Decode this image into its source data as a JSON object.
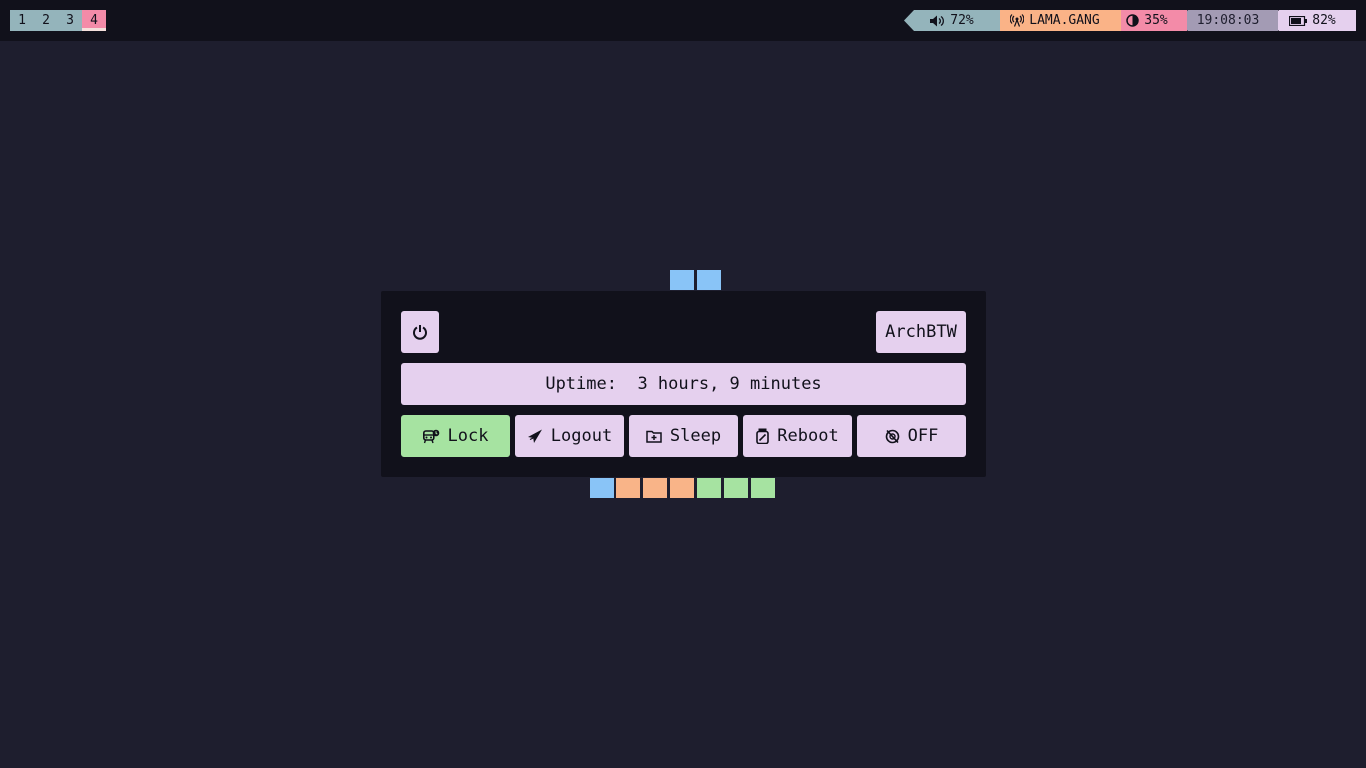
{
  "workspaces": [
    {
      "label": "1",
      "active": false
    },
    {
      "label": "2",
      "active": false
    },
    {
      "label": "3",
      "active": false
    },
    {
      "label": "4",
      "active": true
    }
  ],
  "status_bar": {
    "volume": {
      "icon": "speaker-icon",
      "value": "72%"
    },
    "network": {
      "icon": "wifi-tower-icon",
      "value": "LAMA.GANG"
    },
    "brightness": {
      "icon": "brightness-icon",
      "value": "35%"
    },
    "clock": {
      "value": "19:08:03"
    },
    "battery": {
      "icon": "battery-icon",
      "value": "82%"
    }
  },
  "power_menu": {
    "power_icon": "power-icon",
    "hostname": "ArchBTW",
    "uptime": "Uptime:  3 hours, 9 minutes",
    "actions": [
      {
        "label": "Lock",
        "icon": "lock-screen-icon"
      },
      {
        "label": "Logout",
        "icon": "logout-icon"
      },
      {
        "label": "Sleep",
        "icon": "sleep-icon"
      },
      {
        "label": "Reboot",
        "icon": "reboot-icon"
      },
      {
        "label": "OFF",
        "icon": "power-off-icon"
      }
    ]
  },
  "colors": {
    "background": "#1e1e2e",
    "panel": "#11111b",
    "button": "#e5d0ee",
    "lock_button": "#a6e3a1",
    "workspace": "#94b4bb",
    "workspace_active": "#f38ba8",
    "network_module": "#fab387",
    "decor_blue": "#89c4f7",
    "decor_peach": "#f9b488",
    "decor_green": "#a6e3a1"
  }
}
